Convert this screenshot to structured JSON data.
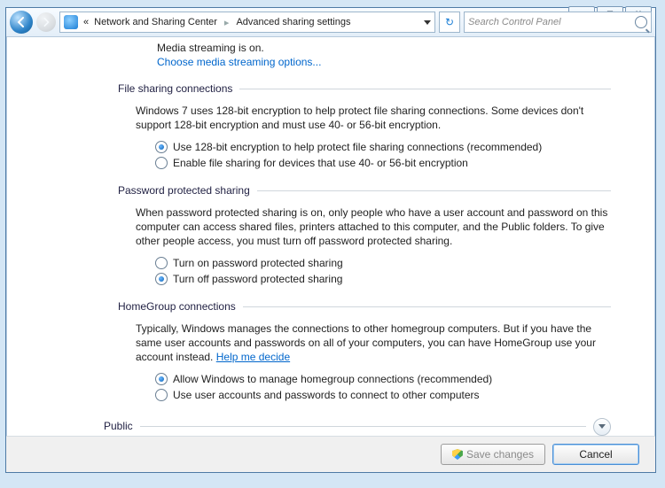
{
  "window_controls": {
    "min": "—",
    "max": "▢",
    "close": "✕"
  },
  "breadcrumb": {
    "parent": "Network and Sharing Center",
    "current": "Advanced sharing settings",
    "sep": "▸",
    "lead": "«"
  },
  "search": {
    "placeholder": "Search Control Panel"
  },
  "media": {
    "status": "Media streaming is on.",
    "link": "Choose media streaming options..."
  },
  "filesharing": {
    "title": "File sharing connections",
    "desc": "Windows 7 uses 128-bit encryption to help protect file sharing connections. Some devices don't support 128-bit encryption and must use 40- or 56-bit encryption.",
    "opt128": "Use 128-bit encryption to help protect file sharing connections (recommended)",
    "opt40": "Enable file sharing for devices that use 40- or 56-bit encryption"
  },
  "password": {
    "title": "Password protected sharing",
    "desc": "When password protected sharing is on, only people who have a user account and password on this computer can access shared files, printers attached to this computer, and the Public folders. To give other people access, you must turn off password protected sharing.",
    "optOn": "Turn on password protected sharing",
    "optOff": "Turn off password protected sharing"
  },
  "homegroup": {
    "title": "HomeGroup connections",
    "desc": "Typically, Windows manages the connections to other homegroup computers. But if you have the same user accounts and passwords on all of your computers, you can have HomeGroup use your account instead. ",
    "help": "Help me decide",
    "optAllow": "Allow Windows to manage homegroup connections (recommended)",
    "optUser": "Use user accounts and passwords to connect to other computers"
  },
  "profile": {
    "label": "Public"
  },
  "buttons": {
    "save": "Save changes",
    "cancel": "Cancel"
  }
}
